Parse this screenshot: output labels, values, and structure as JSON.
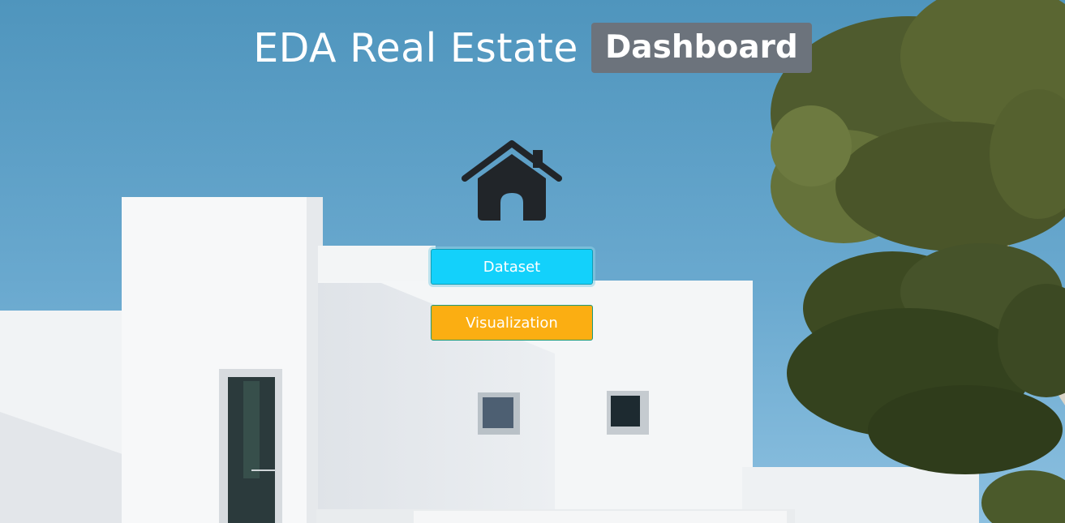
{
  "header": {
    "title": "EDA Real Estate",
    "badge": "Dashboard"
  },
  "icons": {
    "home": "home-icon"
  },
  "buttons": {
    "dataset": "Dataset",
    "visualization": "Visualization"
  },
  "colors": {
    "dataset_button": "#13d1fb",
    "visualization_button": "#fbae12",
    "badge_background": "#6c737c"
  }
}
